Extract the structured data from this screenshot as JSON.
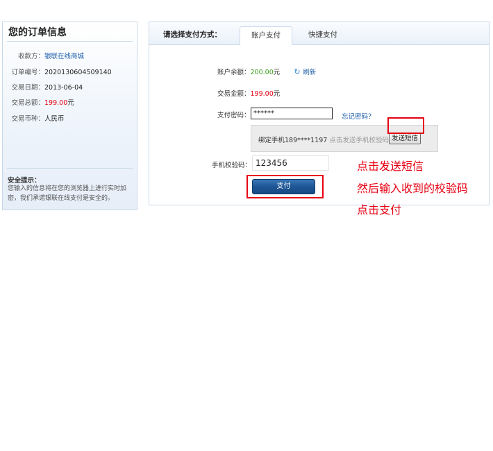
{
  "order": {
    "title": "您的订单信息",
    "rows": [
      {
        "label": "收款方：",
        "value": "银联在线商城",
        "style": "link"
      },
      {
        "label": "订单编号：",
        "value": "2020130604509140",
        "style": ""
      },
      {
        "label": "交易日期：",
        "value": "2013-06-04",
        "style": ""
      },
      {
        "label": "交易总额：",
        "value": "199.00",
        "unit": "元",
        "style": "red"
      },
      {
        "label": "交易币种：",
        "value": "人民币",
        "style": ""
      }
    ],
    "tip_title": "安全提示：",
    "tip_text": "您输入的信息将在您的浏览器上进行实时加密，我们承诺银联在线支付是安全的。"
  },
  "payment": {
    "header_label": "请选择支付方式：",
    "tabs": [
      {
        "label": "账户支付",
        "active": true
      },
      {
        "label": "快捷支付",
        "active": false
      }
    ],
    "balance_label": "账户余额：",
    "balance_value": "200.00",
    "balance_unit": "元",
    "refresh_label": "刷新",
    "amount_label": "交易金额：",
    "amount_value": "199.00",
    "amount_unit": "元",
    "password_label": "支付密码：",
    "password_value": "******",
    "forgot_label": "忘记密码？",
    "sms_bound_text": "绑定手机189****1197",
    "sms_hint": "点击发送手机校验码",
    "sms_button": "发送短信",
    "code_label": "手机校验码：",
    "code_value": "123456",
    "pay_button": "支付"
  },
  "annotations": [
    "点击发送短信",
    "然后输入收到的校验码",
    "点击支付"
  ],
  "colors": {
    "accent_red": "#e60012",
    "link_blue": "#1d5fa8",
    "balance_green": "#3b9c1a",
    "button_blue": "#1f5695"
  }
}
